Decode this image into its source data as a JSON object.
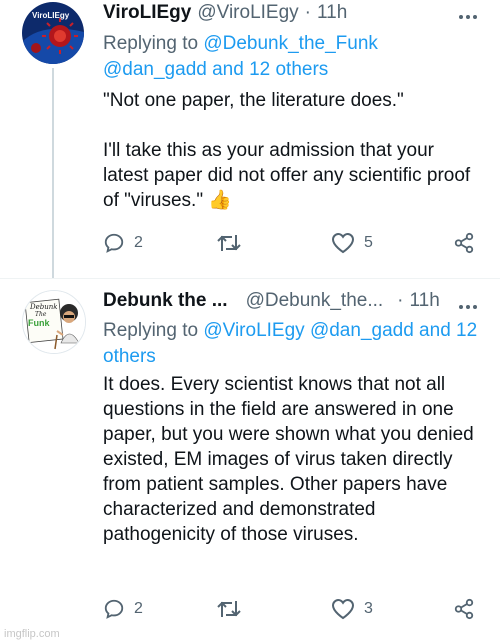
{
  "tweets": [
    {
      "display_name": "ViroLIEgy",
      "handle": "@ViroLIEgy",
      "separator": "·",
      "time": "11h",
      "replying_label": "Replying to",
      "replying_to": [
        "@Debunk_the_Funk",
        "@dan_gadd and 12 others"
      ],
      "body": [
        "\"Not one paper, the literature does.\"",
        "I'll take this as your admission that your latest paper did not offer any scientific proof of \"viruses.\" 👍"
      ],
      "replies": "2",
      "retweets": "",
      "likes": "5",
      "avatar_text": "ViroLIEgy"
    },
    {
      "display_name": "Debunk the ...",
      "handle": "@Debunk_the...",
      "separator": "·",
      "time": "11h",
      "replying_label": "Replying to",
      "replying_to": [
        "@ViroLIEgy",
        "@dan_gadd and 12 others"
      ],
      "body": [
        "It does. Every scientist knows that not all questions in the field are answered in one paper, but you were shown what you denied existed, EM images of virus taken directly from patient samples. Other papers have characterized and demonstrated pathogenicity of those viruses."
      ],
      "replies": "2",
      "retweets": "",
      "likes": "3",
      "avatar_text": [
        "Debunk",
        "The",
        "Funk"
      ]
    }
  ],
  "icons": {
    "more": "more-horizontal-icon",
    "reply": "reply-icon",
    "retweet": "retweet-icon",
    "like": "heart-icon",
    "share": "share-icon"
  },
  "colors": {
    "link": "#1d9bf0",
    "muted": "#536471",
    "text": "#0f1419"
  },
  "watermark": "imgflip.com"
}
